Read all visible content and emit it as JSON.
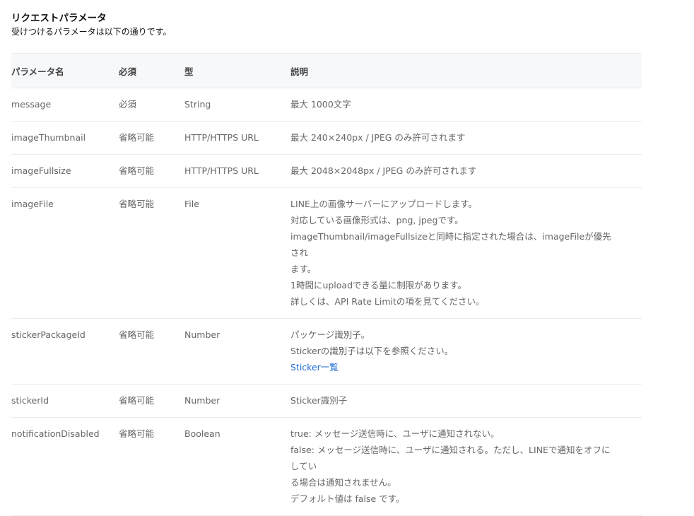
{
  "section": {
    "title": "リクエストパラメータ",
    "description": "受けつけるパラメータは以下の通りです。"
  },
  "table": {
    "headers": [
      "パラメータ名",
      "必須",
      "型",
      "説明"
    ],
    "rows": [
      {
        "name": "message",
        "required": "必須",
        "type": "String",
        "desc": [
          "最大 1000文字"
        ]
      },
      {
        "name": "imageThumbnail",
        "required": "省略可能",
        "type": "HTTP/HTTPS URL",
        "desc": [
          "最大 240×240px / JPEG のみ許可されます"
        ]
      },
      {
        "name": "imageFullsize",
        "required": "省略可能",
        "type": "HTTP/HTTPS URL",
        "desc": [
          "最大 2048×2048px / JPEG のみ許可されます"
        ]
      },
      {
        "name": "imageFile",
        "required": "省略可能",
        "type": "File",
        "desc": [
          "LINE上の画像サーバーにアップロードします。",
          "対応している画像形式は、png, jpegです。",
          "imageThumbnail/imageFullsizeと同時に指定された場合は、imageFileが優先され",
          "ます。",
          "1時間にuploadできる量に制限があります。",
          "詳しくは、API Rate Limitの項を見てください。"
        ]
      },
      {
        "name": "stickerPackageId",
        "required": "省略可能",
        "type": "Number",
        "desc": [
          "パッケージ識別子。",
          "Stickerの識別子は以下を参照ください。"
        ],
        "link": "Sticker一覧"
      },
      {
        "name": "stickerId",
        "required": "省略可能",
        "type": "Number",
        "desc": [
          "Sticker識別子"
        ]
      },
      {
        "name": "notificationDisabled",
        "required": "省略可能",
        "type": "Boolean",
        "desc": [
          "true: メッセージ送信時に、ユーザに通知されない。",
          "false: メッセージ送信時に、ユーザに通知される。ただし、LINEで通知をオフにしてい",
          "る場合は通知されません。",
          "デフォルト値は false です。"
        ]
      }
    ]
  },
  "colors": {
    "link": "#1e6bd6",
    "header_bg": "#f7f8fa",
    "border": "#ececec"
  }
}
